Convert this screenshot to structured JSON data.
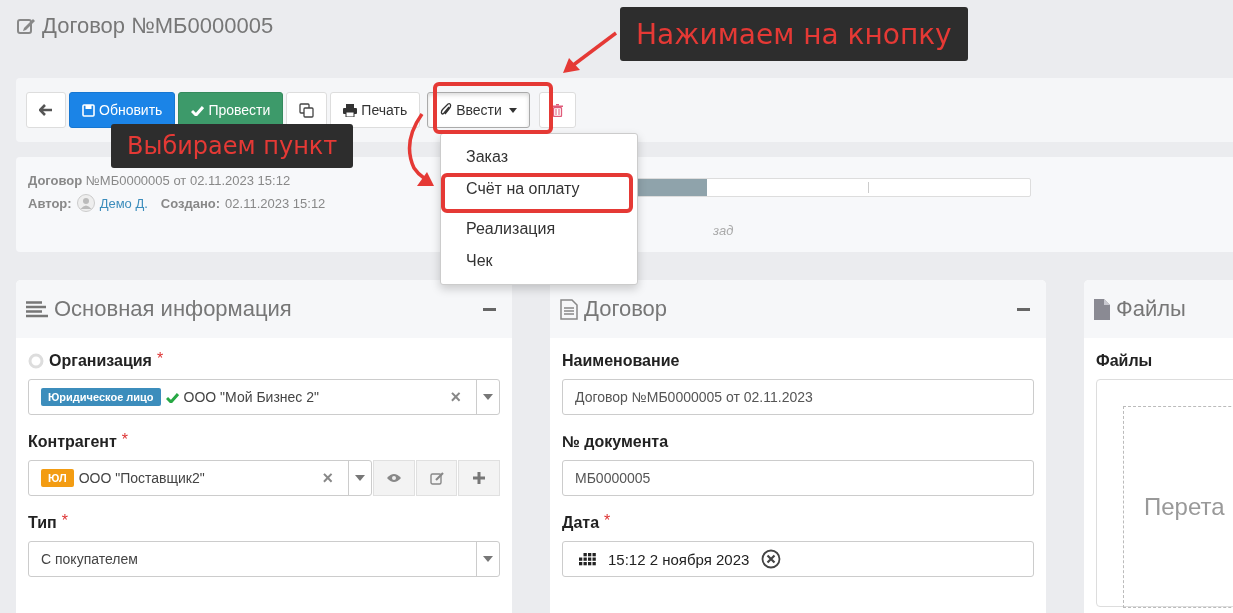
{
  "page_title": "Договор №МБ0000005",
  "toolbar": [
    {
      "kind": "back"
    },
    {
      "kind": "primary",
      "label": "Обновить"
    },
    {
      "kind": "success",
      "label": "Провести"
    },
    {
      "kind": "copy"
    },
    {
      "kind": "print",
      "label": "Печать"
    },
    {
      "kind": "dropdown",
      "label": "Ввести",
      "expanded": true
    },
    {
      "kind": "delete"
    }
  ],
  "dropdown_menu": [
    {
      "label": "Заказ",
      "highlighted": false
    },
    {
      "label": "Счёт на оплату",
      "highlighted": true
    },
    {
      "label": "Реализация",
      "highlighted": false
    },
    {
      "label": "Чек",
      "highlighted": false
    }
  ],
  "info": {
    "doc_label": "Договор",
    "doc_value": "№МБ0000005 от 02.11.2023 15:12",
    "author_label": "Автор:",
    "author": "Демо Д.",
    "created_label": "Создано:",
    "created": "02.11.2023 15:12",
    "progress": {
      "level": 0.38
    },
    "note": "зад"
  },
  "cards": [
    {
      "kind": "main",
      "title": "Основная информация",
      "fields": [
        {
          "kind": "org",
          "label": "Организация",
          "required_mark": "*",
          "badge": "Юридическое лицо",
          "color": "#3c8dbc",
          "verified": true,
          "value": "ООО \"Мой Бизнес 2\"",
          "clear": "×"
        },
        {
          "kind": "party",
          "label": "Контрагент",
          "required_mark": "*",
          "badge": "ЮЛ",
          "color": "#f39c12",
          "verified": false,
          "value": "ООО \"Поставщик2\"",
          "clear": "×"
        },
        {
          "kind": "select",
          "label": "Тип",
          "required_mark": "*",
          "value": "С покупателем"
        }
      ]
    },
    {
      "kind": "contract",
      "title": "Договор",
      "fields": [
        {
          "kind": "input",
          "label": "Наименование",
          "value": "Договор №МБ0000005 от 02.11.2023"
        },
        {
          "kind": "input",
          "label": "№ документа",
          "value": "МБ0000005"
        },
        {
          "kind": "date",
          "label": "Дата",
          "required_mark": "*",
          "value": "15:12 2 ноября 2023"
        }
      ]
    },
    {
      "kind": "files",
      "title": "Файлы",
      "fields": [
        {
          "kind": "dropzone",
          "label": "Файлы",
          "value": "Перета"
        }
      ]
    }
  ],
  "annotations": [
    {
      "kind": "top",
      "text": "Нажимаем на кнопку"
    },
    {
      "kind": "left",
      "text": "Выбираем пункт"
    }
  ]
}
